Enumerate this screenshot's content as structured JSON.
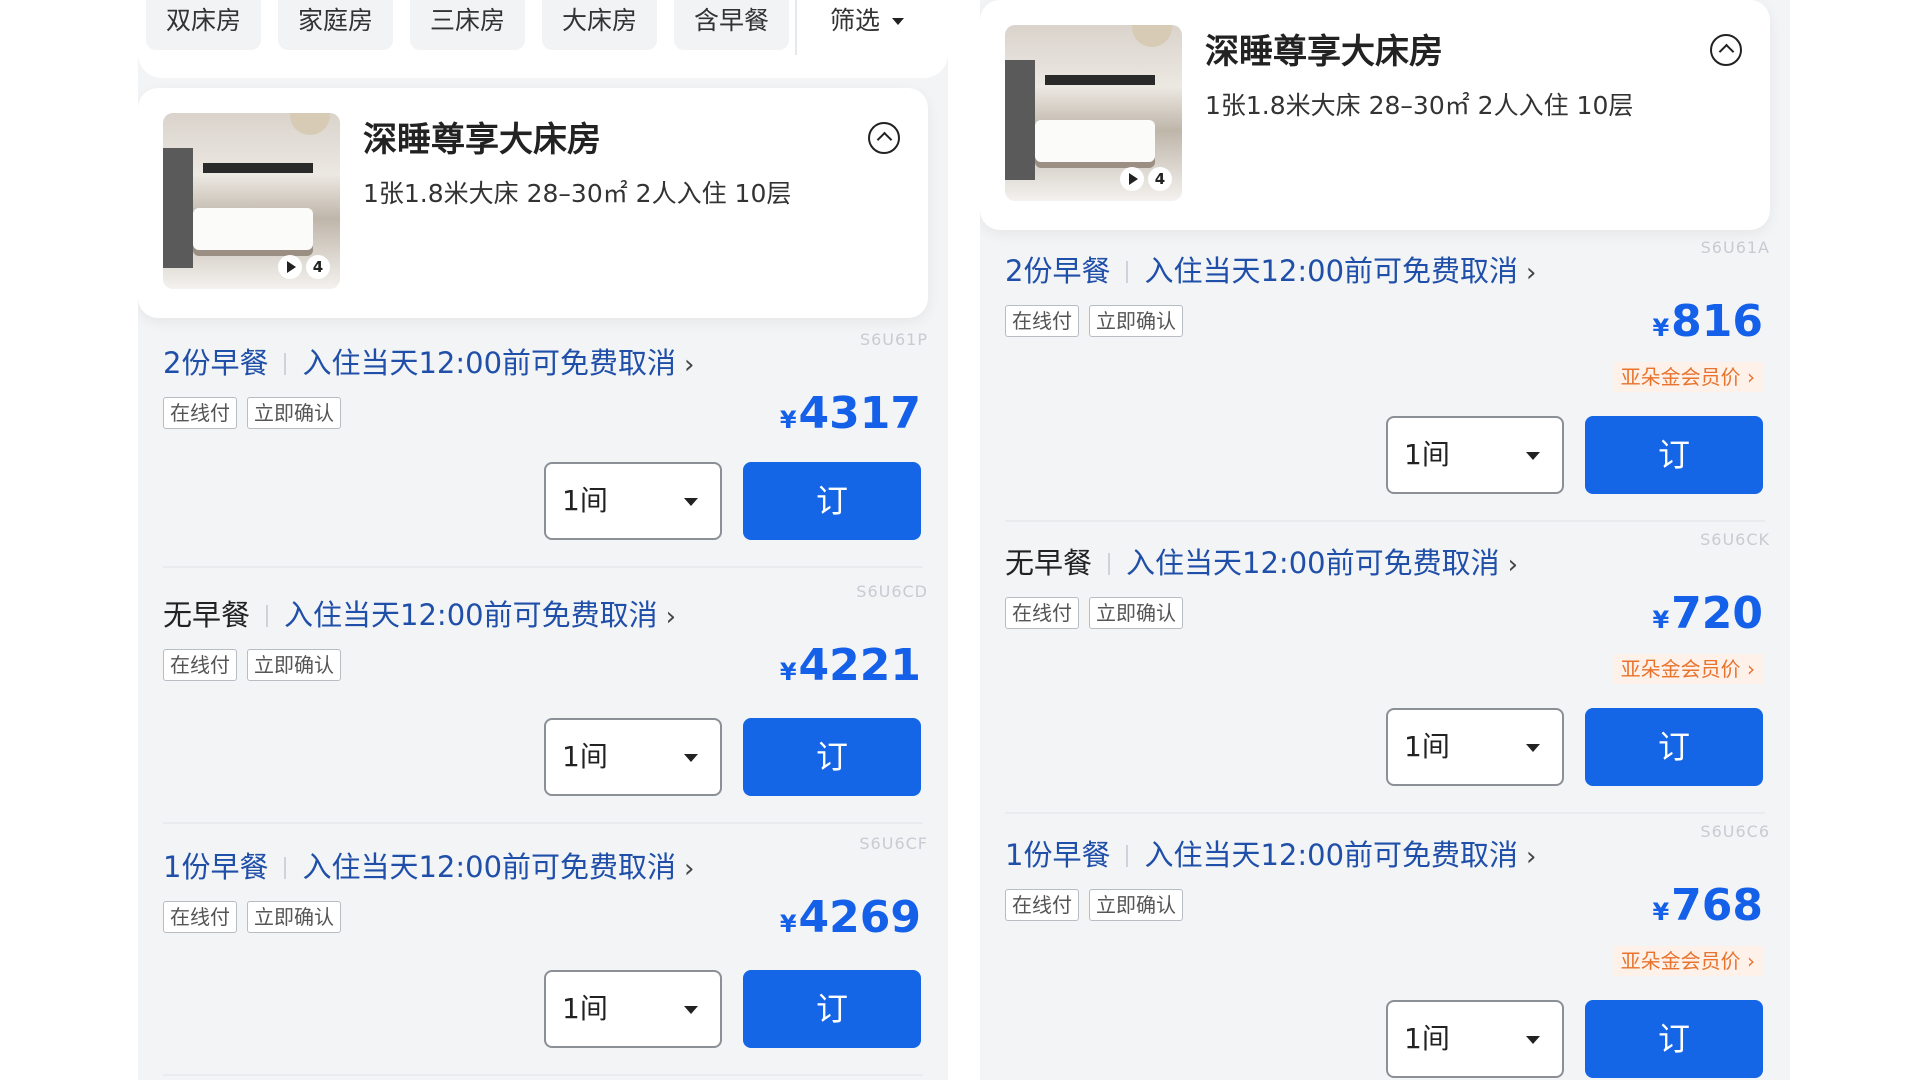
{
  "filters": [
    "双床房",
    "家庭房",
    "三床房",
    "大床房",
    "含早餐"
  ],
  "filter_screen_label": "筛选",
  "room": {
    "title": "深睡尊享大床房",
    "spec": "1张1.8米大床  28–30㎡  2人入住  10层",
    "media_count": "4"
  },
  "common": {
    "tag_online": "在线付",
    "tag_instant": "立即确认",
    "qty": "1间",
    "book_label": "订",
    "currency": "¥",
    "member_label": "亚朵金会员价",
    "chevron": "›",
    "policy": "入住当天12:00前可免费取消"
  },
  "left_rates": [
    {
      "meal": "2份早餐",
      "code": "S6U61P",
      "price": "4317"
    },
    {
      "meal": "无早餐",
      "code": "S6U6CD",
      "price": "4221"
    },
    {
      "meal": "1份早餐",
      "code": "S6U6CF",
      "price": "4269"
    }
  ],
  "right_rates": [
    {
      "meal": "2份早餐",
      "code": "S6U61A",
      "price": "816"
    },
    {
      "meal": "无早餐",
      "code": "S6U6CK",
      "price": "720"
    },
    {
      "meal": "1份早餐",
      "code": "S6U6C6",
      "price": "768"
    }
  ],
  "colors": {
    "accent": "#1466e6",
    "link": "#1f4fa8",
    "member": "#e8732d"
  }
}
